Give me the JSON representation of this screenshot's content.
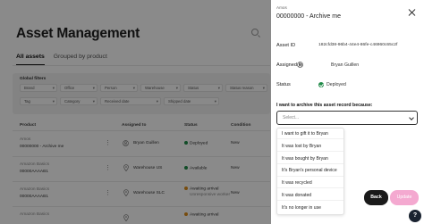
{
  "page": {
    "title": "Asset Management",
    "tabs": [
      {
        "label": "All assets",
        "active": true
      },
      {
        "label": "Grouped by product",
        "active": false
      }
    ],
    "filters": {
      "title": "Global filters",
      "row1": [
        "Brand",
        "Office",
        "Person",
        "Warehouse",
        "Status",
        "Status reason"
      ],
      "row2": [
        "Tag",
        "Category",
        "Received date",
        "Shipped date"
      ]
    },
    "table": {
      "headers": [
        "Product",
        "Assigned to",
        "Status",
        "Condition"
      ],
      "rows": [
        {
          "brand": "Amos",
          "product": "00000000 - Archive me",
          "assigned": "Bryan Guillen",
          "assigned_type": "person",
          "status": "Deployed",
          "status_color": "#1f8a47",
          "condition": "New"
        },
        {
          "brand": "Amazon Basics",
          "product": "00000AAAAB1",
          "assigned": "Warehouse US",
          "assigned_type": "location",
          "status": "Available",
          "status_color": "#1f8a47",
          "condition": "New"
        },
        {
          "brand": "Amazon Basics",
          "product": "00000AAAAB1",
          "assigned": "Warehouse SLC",
          "assigned_type": "location",
          "status": "Awaiting arrival",
          "status_sub": "Unresponsive worker",
          "status_color": "#d98a1b",
          "condition": "New"
        },
        {
          "brand": "Amazon Basics",
          "product": "",
          "assigned": "",
          "assigned_type": "location",
          "status": "Awaiting arrival",
          "status_color": "#d98a1b",
          "condition": ""
        }
      ]
    }
  },
  "panel": {
    "subtitle": "Amos",
    "title": "00000000 - Archive me",
    "asset_id_label": "Asset ID",
    "asset_id_value": "182cfd38-96b4-44e4-86fe-c46960c65c2f",
    "assigned_label": "Assigned to",
    "assigned_value": "Bryan Guillen",
    "status_label": "Status",
    "status_value": "Deployed",
    "question": "I want to archive this asset record because:",
    "select_placeholder": "Select...",
    "options": [
      "I want to gift it to Bryan",
      "It was lost by Bryan",
      "It was bought by Bryan",
      "It's Bryan's personal device",
      "It was recycled",
      "It was donated",
      "It's no longer in use"
    ],
    "back_label": "Back",
    "update_label": "Update"
  },
  "help": {
    "label": "?"
  },
  "icons": {
    "close": "close-icon",
    "chevron": "chevron-down-icon",
    "person": "person-icon",
    "location": "location-pin-icon",
    "check": "check-circle-icon",
    "search": "search-icon"
  },
  "colors": {
    "accent_pink": "#f4a9d0",
    "deployed_green": "#1f8a47",
    "awaiting_orange": "#d98a1b"
  }
}
